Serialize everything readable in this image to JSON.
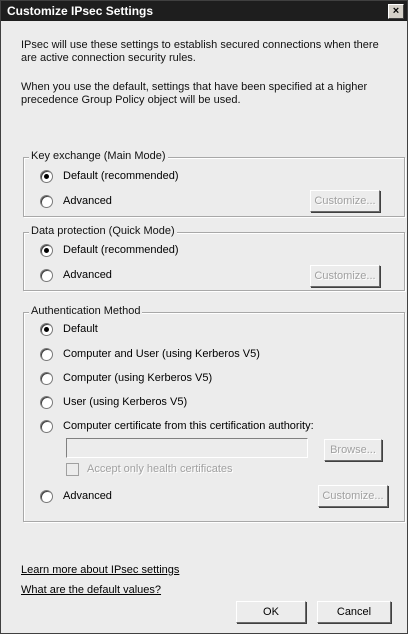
{
  "window": {
    "title": "Customize IPsec Settings",
    "close_glyph": "×"
  },
  "intro": {
    "line1": "IPsec will use these settings to establish secured connections when there are active connection security rules.",
    "line2": "When you use the default, settings that have been specified at a higher precedence Group Policy object will be used."
  },
  "key_exchange": {
    "label": "Key exchange (Main Mode)",
    "options": [
      {
        "label": "Default (recommended)",
        "checked": true
      },
      {
        "label": "Advanced",
        "checked": false
      }
    ],
    "customize_label": "Customize..."
  },
  "data_protection": {
    "label": "Data protection (Quick Mode)",
    "options": [
      {
        "label": "Default (recommended)",
        "checked": true
      },
      {
        "label": "Advanced",
        "checked": false
      }
    ],
    "customize_label": "Customize..."
  },
  "authentication": {
    "label": "Authentication Method",
    "options": [
      {
        "label": "Default",
        "checked": true
      },
      {
        "label": "Computer and User (using Kerberos V5)",
        "checked": false
      },
      {
        "label": "Computer (using Kerberos V5)",
        "checked": false
      },
      {
        "label": "User (using Kerberos V5)",
        "checked": false
      },
      {
        "label": "Computer certificate from this certification authority:",
        "checked": false
      },
      {
        "label": "Advanced",
        "checked": false
      }
    ],
    "certificate_value": "",
    "browse_label": "Browse...",
    "health_cert_label": "Accept only health certificates",
    "customize_label": "Customize..."
  },
  "links": {
    "learn_more": "Learn more about IPsec settings",
    "defaults": "What are the default values?"
  },
  "footer": {
    "ok_label": "OK",
    "cancel_label": "Cancel"
  }
}
